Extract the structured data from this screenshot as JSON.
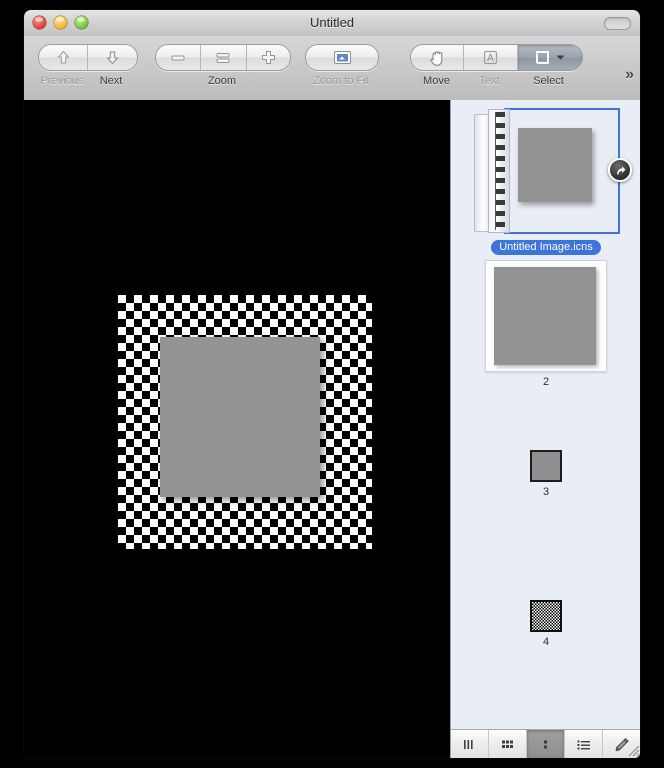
{
  "window": {
    "title": "Untitled",
    "traffic_lights": [
      {
        "name": "close",
        "color": "#e24b3f"
      },
      {
        "name": "minimize",
        "color": "#f4bc3f"
      },
      {
        "name": "zoom",
        "color": "#79c93f"
      }
    ],
    "toolbar_toggle_label": ""
  },
  "toolbar": {
    "navigate": {
      "label": "",
      "previous_label": "Previous",
      "next_label": "Next",
      "previous_icon": "arrow-up-icon",
      "next_icon": "arrow-down-icon",
      "enabled": false
    },
    "zoom": {
      "label": "Zoom",
      "zoom_out_icon": "minus-icon",
      "actual_size_icon": "equals-icon",
      "zoom_in_icon": "plus-icon"
    },
    "zoom_to_fit": {
      "label": "Zoom to Fit",
      "icon": "fit-screen-icon",
      "enabled": false
    },
    "tools": {
      "move_label": "Move",
      "move_icon": "hand-icon",
      "text_label": "Text",
      "text_icon": "text-a-icon",
      "select_label": "Select",
      "select_icon": "marquee-select-icon",
      "select_active": true,
      "select_menu_icon": "chevron-down-icon"
    },
    "overflow_label": "»"
  },
  "canvas": {
    "image_alt": "gray-square-on-transparent-checkerboard",
    "background_color": "#000000",
    "square_color": "#939393"
  },
  "sidebar": {
    "items": [
      {
        "label": "Untitled Image.icns",
        "selected": true,
        "kind": "document-stack",
        "reveal_icon": "reveal-arrow-icon"
      },
      {
        "label": "2",
        "selected": false,
        "kind": "page-thumbnail"
      },
      {
        "label": "3",
        "selected": false,
        "kind": "small-square"
      },
      {
        "label": "4",
        "selected": false,
        "kind": "dithered-square"
      }
    ],
    "view_buttons": [
      {
        "name": "filmstrip-view",
        "icon": "columns-icon",
        "active": false
      },
      {
        "name": "grid-view",
        "icon": "grid-icon",
        "active": false
      },
      {
        "name": "single-column-view",
        "icon": "two-dots-icon",
        "active": true
      },
      {
        "name": "list-view",
        "icon": "list-icon",
        "active": false
      },
      {
        "name": "annotate-tool",
        "icon": "pencil-icon",
        "active": false
      }
    ],
    "selection_color": "#3c74d9"
  }
}
